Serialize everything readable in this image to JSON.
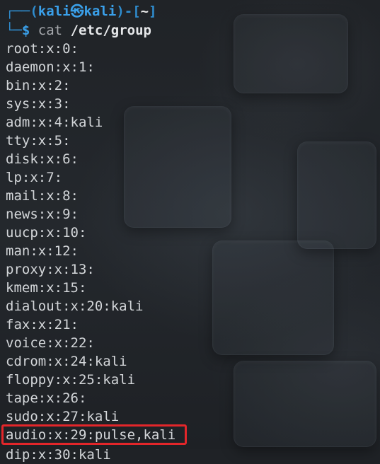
{
  "prompt": {
    "open": "┌──(",
    "user": "kali",
    "at": "㉿",
    "host": "kali",
    "mid": ")-[",
    "cwd": "~",
    "close": "]",
    "corner": "└─",
    "dollar": "$",
    "command": "cat",
    "argument": "/etc/group"
  },
  "lines": [
    "root:x:0:",
    "daemon:x:1:",
    "bin:x:2:",
    "sys:x:3:",
    "adm:x:4:kali",
    "tty:x:5:",
    "disk:x:6:",
    "lp:x:7:",
    "mail:x:8:",
    "news:x:9:",
    "uucp:x:10:",
    "man:x:12:",
    "proxy:x:13:",
    "kmem:x:15:",
    "dialout:x:20:kali",
    "fax:x:21:",
    "voice:x:22:",
    "cdrom:x:24:kali",
    "floppy:x:25:kali",
    "tape:x:26:",
    "sudo:x:27:kali",
    "audio:x:29:pulse,kali"
  ],
  "partial_line": "dip:x:30:kali",
  "highlighted_line_index": 21,
  "colors": {
    "background": "#1f2226",
    "prompt_blue": "#2f8dcf",
    "text": "#d3d6d9",
    "highlight_border": "#e3262a"
  }
}
